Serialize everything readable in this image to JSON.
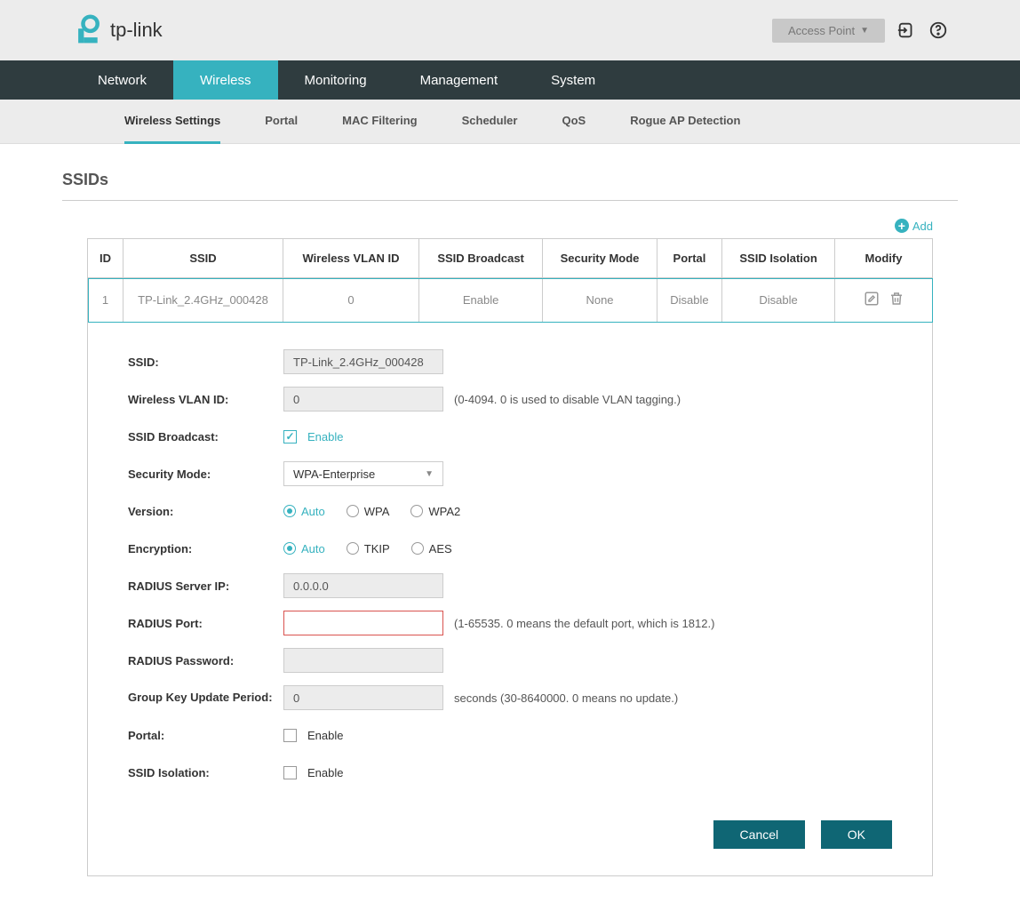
{
  "brand": "tp-link",
  "mode_button": "Access Point",
  "nav": {
    "items": [
      "Network",
      "Wireless",
      "Monitoring",
      "Management",
      "System"
    ],
    "active": "Wireless"
  },
  "subnav": {
    "items": [
      "Wireless Settings",
      "Portal",
      "MAC Filtering",
      "Scheduler",
      "QoS",
      "Rogue AP Detection"
    ],
    "active": "Wireless Settings"
  },
  "section_title": "SSIDs",
  "add_label": "Add",
  "table": {
    "headers": [
      "ID",
      "SSID",
      "Wireless VLAN ID",
      "SSID Broadcast",
      "Security Mode",
      "Portal",
      "SSID Isolation",
      "Modify"
    ],
    "row": {
      "id": "1",
      "ssid": "TP-Link_2.4GHz_000428",
      "vlan": "0",
      "broadcast": "Enable",
      "security": "None",
      "portal": "Disable",
      "isolation": "Disable"
    }
  },
  "form": {
    "ssid_label": "SSID:",
    "ssid_value": "TP-Link_2.4GHz_000428",
    "vlan_label": "Wireless VLAN ID:",
    "vlan_value": "0",
    "vlan_helper": "(0-4094. 0 is used to disable VLAN tagging.)",
    "broadcast_label": "SSID Broadcast:",
    "broadcast_checkbox": "Enable",
    "security_label": "Security Mode:",
    "security_value": "WPA-Enterprise",
    "version_label": "Version:",
    "version_options": [
      "Auto",
      "WPA",
      "WPA2"
    ],
    "encryption_label": "Encryption:",
    "encryption_options": [
      "Auto",
      "TKIP",
      "AES"
    ],
    "radius_ip_label": "RADIUS Server IP:",
    "radius_ip_value": "0.0.0.0",
    "radius_port_label": "RADIUS Port:",
    "radius_port_value": "",
    "radius_port_helper": "(1-65535. 0 means the default port, which is 1812.)",
    "radius_pw_label": "RADIUS Password:",
    "radius_pw_value": "",
    "gkup_label": "Group Key Update Period:",
    "gkup_value": "0",
    "gkup_helper": "seconds (30-8640000. 0 means no update.)",
    "portal_label": "Portal:",
    "portal_checkbox": "Enable",
    "isolation_label": "SSID Isolation:",
    "isolation_checkbox": "Enable"
  },
  "buttons": {
    "cancel": "Cancel",
    "ok": "OK"
  }
}
